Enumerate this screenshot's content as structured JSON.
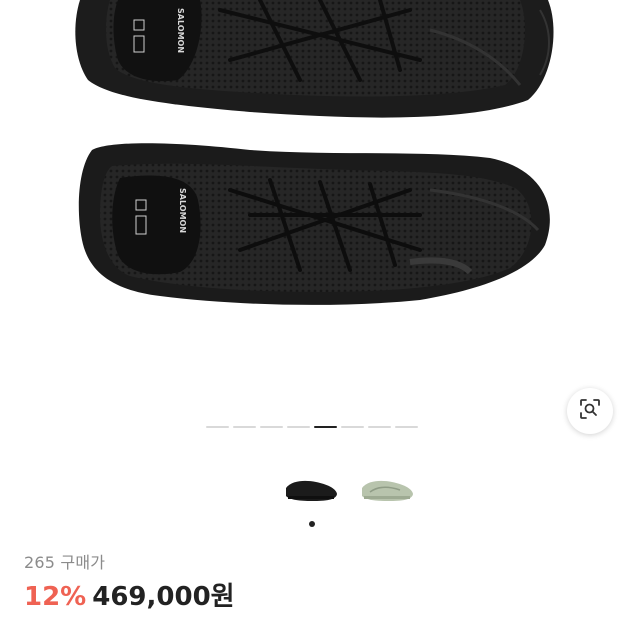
{
  "product": {
    "images_total": 8,
    "active_image_index": 4,
    "brand_print": "SALOMON",
    "variants": [
      {
        "name": "black",
        "color": "#1b1b1b"
      },
      {
        "name": "sage",
        "color": "#b8c4ad"
      }
    ],
    "selected_variant": 0
  },
  "purchase": {
    "size_label": "265 구매가",
    "discount": "12%",
    "price": "469,000원"
  },
  "colors": {
    "discount": "#ef6253",
    "text": "#222222",
    "muted": "#8b8b8b",
    "pager_active": "#222222",
    "pager_inactive": "#d9d9d9"
  },
  "icons": {
    "lens": "visual-search-icon"
  }
}
